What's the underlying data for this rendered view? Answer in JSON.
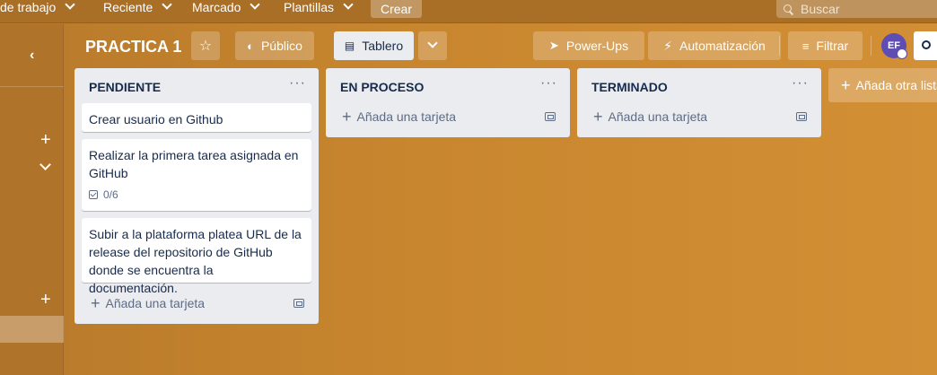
{
  "topnav": {
    "items": [
      "de trabajo",
      "Reciente",
      "Marcado",
      "Plantillas"
    ],
    "create": "Crear",
    "search_placeholder": "Buscar"
  },
  "board": {
    "title": "PRACTICA 1",
    "visibility": "Público",
    "view": "Tablero",
    "powerups": "Power-Ups",
    "automation": "Automatización",
    "filter": "Filtrar",
    "avatar_initials": "EF"
  },
  "lists": [
    {
      "title": "PENDIENTE",
      "cards": [
        {
          "text": "Crear usuario en Github"
        },
        {
          "text": "Realizar la primera tarea asignada en GitHub",
          "checklist": "0/6"
        },
        {
          "text": "Subir a la plataforma platea URL de la release del repositorio de GitHub donde se encuentra la documentación."
        }
      ],
      "add_card": "Añada una tarjeta"
    },
    {
      "title": "EN PROCESO",
      "add_card": "Añada una tarjeta"
    },
    {
      "title": "TERMINADO",
      "add_card": "Añada una tarjeta"
    }
  ],
  "add_list": "Añada otra lista"
}
